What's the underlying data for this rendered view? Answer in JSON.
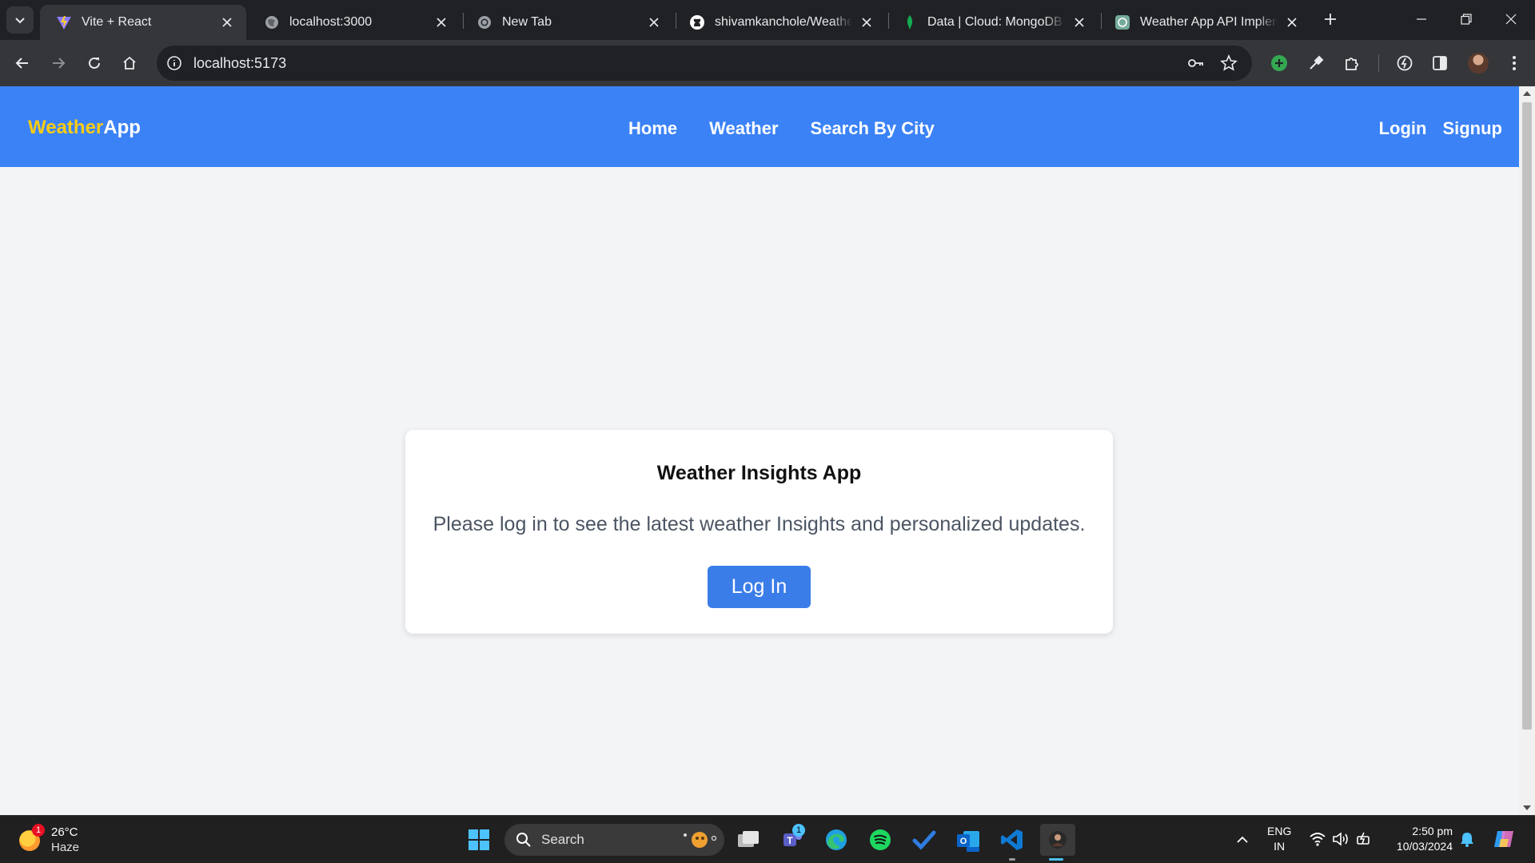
{
  "browser": {
    "tabs": [
      {
        "title": "Vite + React",
        "active": true
      },
      {
        "title": "localhost:3000",
        "active": false
      },
      {
        "title": "New Tab",
        "active": false
      },
      {
        "title": "shivamkanchole/Weather_",
        "active": false
      },
      {
        "title": "Data | Cloud: MongoDB Cl",
        "active": false
      },
      {
        "title": "Weather App API Impleme",
        "active": false
      }
    ],
    "url": "localhost:5173"
  },
  "app": {
    "brand_part1": "Weather",
    "brand_part2": "App",
    "nav": {
      "home": "Home",
      "weather": "Weather",
      "search_by_city": "Search By City"
    },
    "auth": {
      "login": "Login",
      "signup": "Signup"
    },
    "card": {
      "title": "Weather Insights App",
      "message": "Please log in to see the latest weather Insights and personalized updates.",
      "button": "Log In"
    },
    "colors": {
      "navbar": "#3b82f6",
      "brand_accent": "#facc15",
      "button": "#3b7de8",
      "page_bg": "#f3f4f6"
    }
  },
  "taskbar": {
    "weather": {
      "temperature": "26°C",
      "condition": "Haze",
      "badge": "1"
    },
    "search_label": "Search",
    "teams_badge": "1",
    "tray": {
      "lang_line1": "ENG",
      "lang_line2": "IN"
    },
    "clock": {
      "time": "2:50 pm",
      "date": "10/03/2024"
    }
  }
}
